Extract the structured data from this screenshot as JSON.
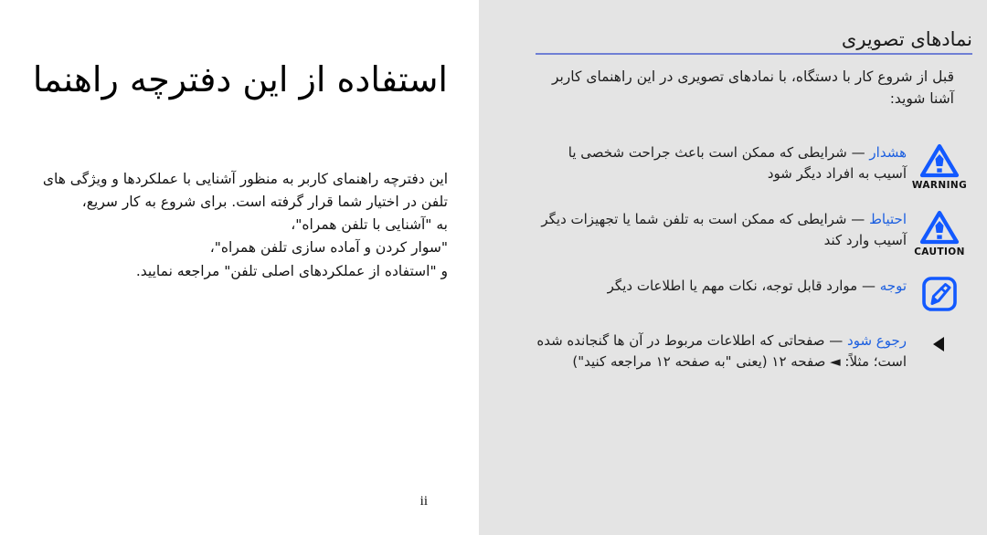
{
  "document": {
    "left_page": {
      "section_title": "نمادهای تصویری",
      "intro": "قبل از شروع کار با دستگاه، با نمادهای تصویری در این راهنمای کاربر آشنا شوید:",
      "rows": [
        {
          "icon_name": "warning-triangle-icon",
          "icon_label": "WARNING",
          "keyword": "هشدار",
          "dash": "—",
          "text": "شرایطی که ممکن است باعث جراحت شخصی یا آسیب به افراد دیگر شود"
        },
        {
          "icon_name": "caution-triangle-icon",
          "icon_label": "CAUTION",
          "keyword": "احتیاط",
          "dash": "—",
          "text": "شرایطی که ممکن است به تلفن شما یا تجهیزات دیگر آسیب وارد کند"
        },
        {
          "icon_name": "note-pen-icon",
          "icon_label": "",
          "keyword": "توجه",
          "dash": "—",
          "text": "موارد قابل توجه، نکات مهم یا اطلاعات دیگر"
        },
        {
          "icon_name": "left-triangle-arrow-icon",
          "icon_label": "",
          "keyword": "رجوع شود",
          "dash": "—",
          "text": "صفحاتی که اطلاعات مربوط در آن ها گنجانده شده است؛ مثلاً: ◄ صفحه ۱۲ (یعنی \"به صفحه ۱۲ مراجعه کنید\")"
        }
      ]
    },
    "right_page": {
      "chapter_title": "استفاده از این دفترچه راهنما",
      "body_lines": [
        "این دفترچه راهنمای کاربر به منظور آشنایی با عملکردها و ویژگی های تلفن در اختیار شما قرار گرفته است. برای شروع به کار سریع،",
        "به \"آشنایی با تلفن همراه\"،",
        "\"سوار کردن و آماده سازی تلفن همراه\"،",
        "و \"استفاده از عملکردهای اصلی تلفن\" مراجعه نمایید."
      ],
      "folio": "ii"
    },
    "colors": {
      "left_page_bg": "#e4e4e4",
      "right_page_bg": "#ffffff",
      "accent_blue": "#1c5fe0",
      "rule_purple": "#6f7fd4",
      "icon_blue": "#1259ff",
      "text": "#1d1d1d"
    }
  }
}
